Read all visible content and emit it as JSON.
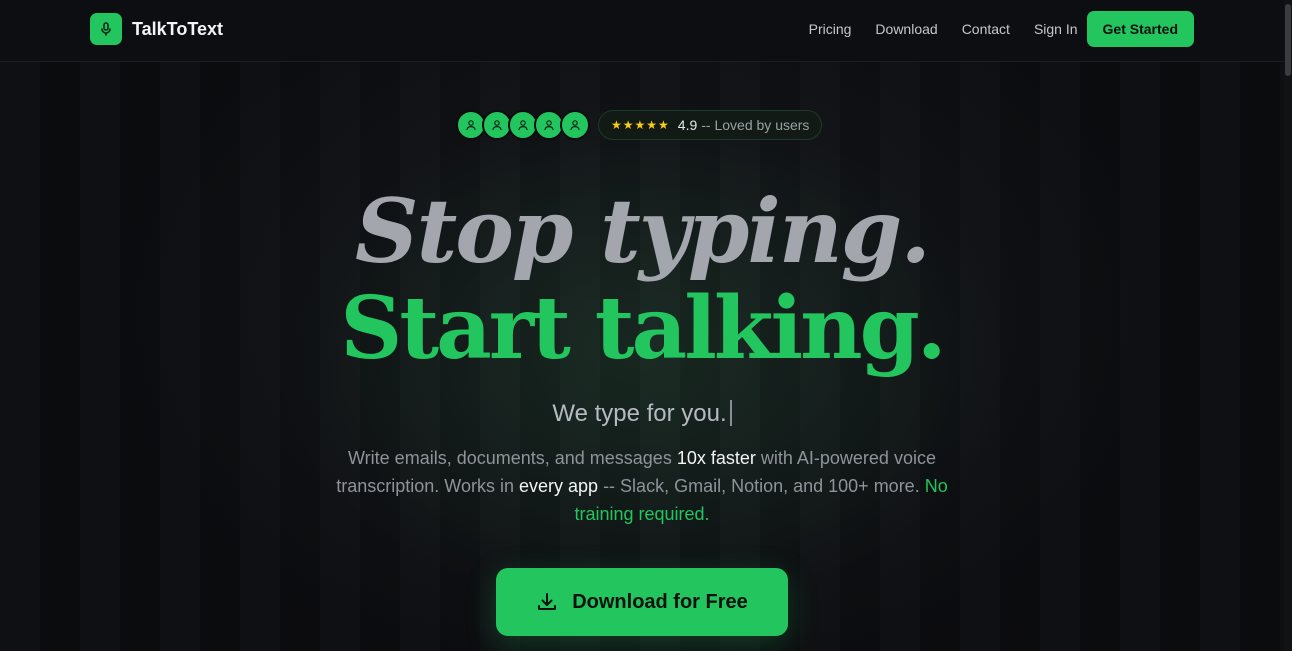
{
  "brand": {
    "name": "TalkToText",
    "accent": "#22c55e",
    "logo_icon": "microphone-icon"
  },
  "nav": {
    "links": [
      "Pricing",
      "Download",
      "Contact",
      "Sign In"
    ],
    "cta": "Get Started"
  },
  "rating": {
    "avatar_count": 5,
    "stars": "★★★★★",
    "score": "4.9",
    "label": "-- Loved by users"
  },
  "hero": {
    "line1": "Stop typing.",
    "line2": "Start talking.",
    "subtitle": "We type for you.",
    "desc": {
      "p1": "Write emails, documents, and messages ",
      "b1": "10x faster",
      "p2": " with AI-powered voice transcription. Works in ",
      "b2": "every app",
      "p3": " -- Slack, Gmail, Notion, and 100+ more. ",
      "g1": "No training required."
    },
    "cta": "Download for Free"
  }
}
